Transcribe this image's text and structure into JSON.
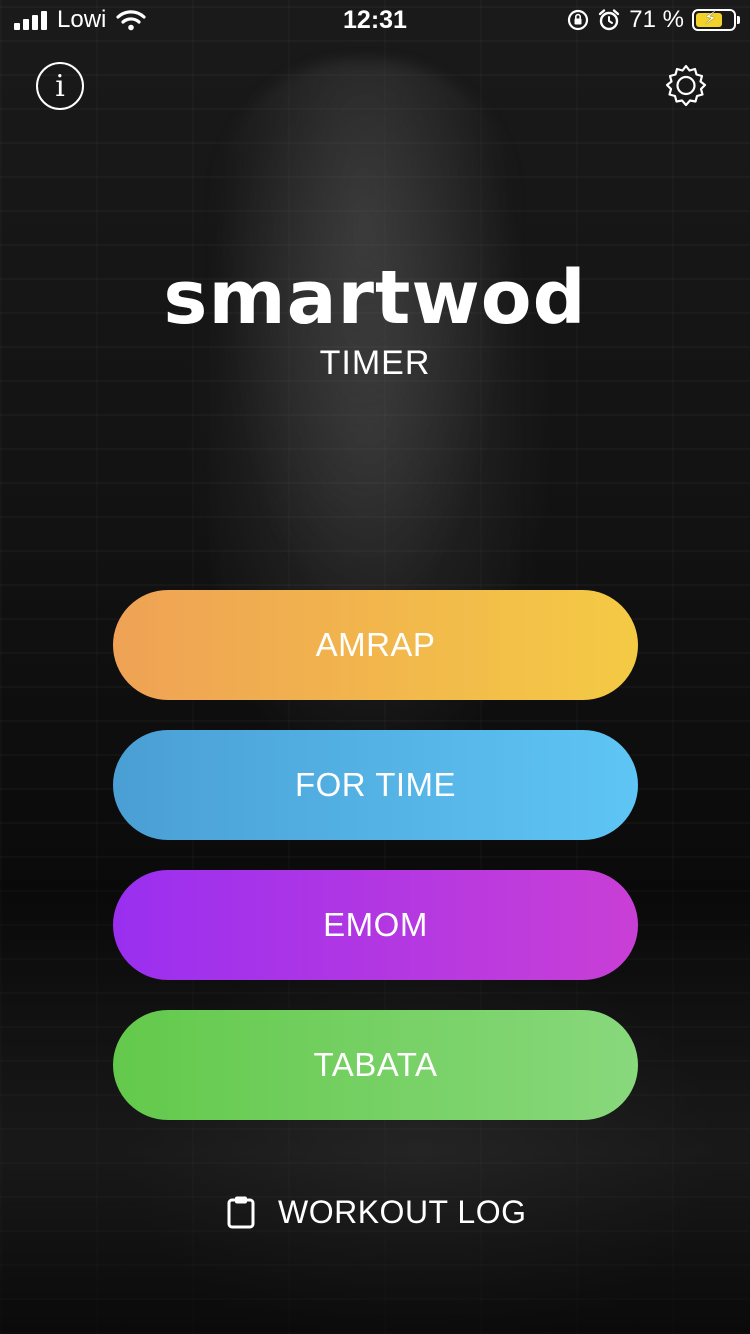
{
  "status_bar": {
    "carrier": "Lowi",
    "time": "12:31",
    "battery_percent": "71 %",
    "battery_level": 0.71,
    "battery_color": "#f2d22a"
  },
  "header": {
    "info_icon": "info-icon",
    "settings_icon": "gear-icon"
  },
  "branding": {
    "logo": "smartwod",
    "subtitle": "TIMER"
  },
  "modes": [
    {
      "label": "AMRAP",
      "colors": [
        "#efa255",
        "#f4ca44"
      ]
    },
    {
      "label": "FOR TIME",
      "colors": [
        "#4a9fd4",
        "#5ec5f4"
      ]
    },
    {
      "label": "EMOM",
      "colors": [
        "#9a2ff0",
        "#c93fd6"
      ]
    },
    {
      "label": "TABATA",
      "colors": [
        "#63c94b",
        "#88d87c"
      ]
    }
  ],
  "workout_log": {
    "label": "WORKOUT LOG",
    "icon": "clipboard-icon"
  }
}
